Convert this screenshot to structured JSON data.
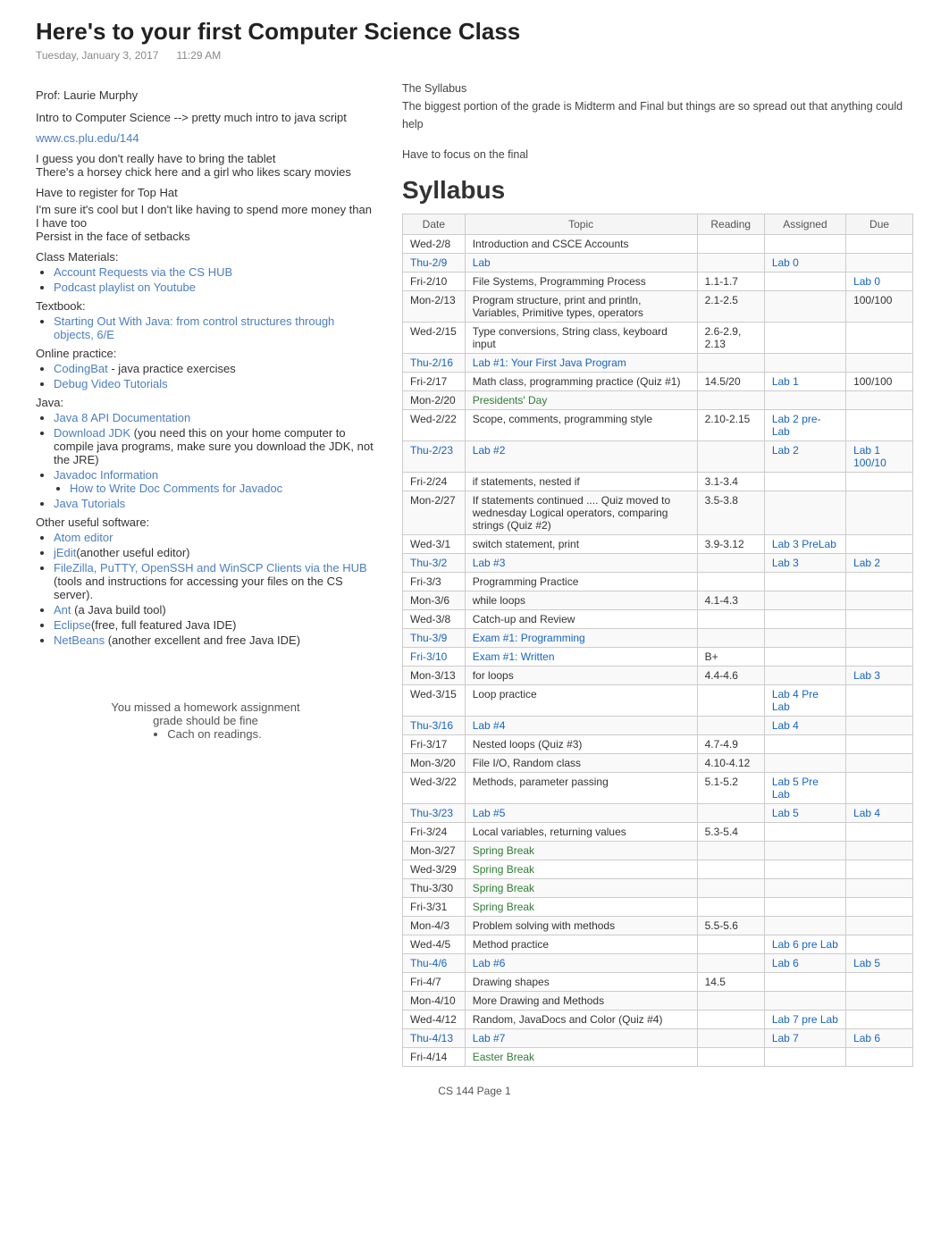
{
  "header": {
    "title": "Here's to your first Computer Science Class",
    "date": "Tuesday, January 3, 2017",
    "time": "11:29 AM"
  },
  "left": {
    "prof_label": "Prof: Laurie Murphy",
    "course_desc": "Intro to Computer Science --> pretty much intro to java script",
    "link_url": "www.cs.plu.edu/144",
    "notes": [
      "I guess you don't really have to bring the tablet",
      "There's a horsey chick here and a girl who likes scary movies"
    ],
    "register_note": "Have to register for Top Hat",
    "persist_notes": [
      "I'm sure it's cool but I don't like having to spend more money than I have too",
      "Persist in the face of setbacks"
    ],
    "class_materials_label": "Class Materials:",
    "class_materials": [
      {
        "text": "Account Requests via the CS HUB",
        "href": "#"
      },
      {
        "text": "Podcast playlist on Youtube",
        "href": "#"
      }
    ],
    "textbook_label": "Textbook:",
    "textbook": [
      {
        "text": "Starting Out With Java: from control structures through objects, 6/E",
        "href": "#"
      }
    ],
    "online_label": "Online practice:",
    "online": [
      {
        "text": "CodingBat",
        "href": "#",
        "suffix": " - java practice exercises"
      },
      {
        "text": "Debug Video Tutorials",
        "href": "#"
      }
    ],
    "java_label": "Java:",
    "java": [
      {
        "text": "Java 8 API Documentation",
        "href": "#"
      },
      {
        "text": "Download JDK",
        "href": "#",
        "suffix": " (you need this on your home computer to compile java programs, make sure you download the JDK, not the JRE)"
      },
      {
        "text": "Javadoc Information",
        "href": "#",
        "children": [
          {
            "text": "How to Write Doc Comments for Javadoc",
            "href": "#"
          }
        ]
      },
      {
        "text": "Java Tutorials",
        "href": "#"
      }
    ],
    "other_label": "Other useful software:",
    "other": [
      {
        "text": "Atom editor",
        "href": "#"
      },
      {
        "text": "jEdit",
        "href": "#",
        "suffix": "(another useful editor)"
      },
      {
        "text": "FileZilla, PuTTY, OpenSSH and WinSCP Clients via the HUB",
        "href": "#",
        "suffix": " (tools and instructions for accessing your files on the CS server)."
      },
      {
        "text": "Ant",
        "href": "#",
        "suffix": " (a Java build tool)"
      },
      {
        "text": "Eclipse",
        "href": "#",
        "suffix": "(free, full featured Java IDE)"
      },
      {
        "text": "NetBeans",
        "href": "#",
        "suffix": " (another excellent and free Java IDE)"
      }
    ],
    "note_box": {
      "line1": "You missed a homework assignment",
      "line2": "grade should be fine",
      "bullet": "Cach on readings."
    }
  },
  "right": {
    "syllabus_intro_label": "The Syllabus",
    "syllabus_intro": "The biggest portion of the grade is Midterm and Final but things are so spread out that anything could help",
    "syllabus_note": "Have to focus on the final",
    "syllabus_title": "Syllabus",
    "table_headers": [
      "Date",
      "Topic",
      "Reading",
      "Assigned",
      "Due"
    ],
    "rows": [
      {
        "date": "Wed-2/8",
        "topic": "Introduction and CSCE Accounts",
        "reading": "",
        "assigned": "",
        "due": "",
        "style": "normal"
      },
      {
        "date": "Thu-2/9",
        "topic": "Lab",
        "reading": "",
        "assigned": "Lab 0",
        "due": "",
        "style": "lab",
        "topic_color": "blue",
        "assigned_color": "blue"
      },
      {
        "date": "Fri-2/10",
        "topic": "File Systems, Programming Process",
        "reading": "1.1-1.7",
        "assigned": "",
        "due": "Lab 0",
        "due_color": "blue",
        "style": "normal"
      },
      {
        "date": "Mon-2/13",
        "topic": "Program structure, print and println, Variables, Primitive types, operators",
        "reading": "2.1-2.5",
        "assigned": "",
        "due": "100/100",
        "style": "normal"
      },
      {
        "date": "Wed-2/15",
        "topic": "Type conversions, String class, keyboard input",
        "reading": "2.6-2.9, 2.13",
        "assigned": "",
        "due": "",
        "style": "normal"
      },
      {
        "date": "Thu-2/16",
        "topic": "Lab #1: Your First Java Program",
        "reading": "",
        "assigned": "",
        "due": "",
        "style": "lab",
        "topic_color": "blue"
      },
      {
        "date": "Fri-2/17",
        "topic": "Math class, programming practice (Quiz #1)",
        "reading": "14.5/20",
        "assigned": "Lab 1",
        "due": "100/100",
        "assigned_color": "blue",
        "style": "normal"
      },
      {
        "date": "Mon-2/20",
        "topic": "Presidents' Day",
        "reading": "",
        "assigned": "",
        "due": "",
        "style": "holiday",
        "topic_color": "green"
      },
      {
        "date": "Wed-2/22",
        "topic": "Scope, comments, programming style",
        "reading": "2.10-2.15",
        "assigned": "Lab 2 pre-Lab",
        "due": "",
        "assigned_color": "blue",
        "style": "normal"
      },
      {
        "date": "Thu-2/23",
        "topic": "Lab #2",
        "reading": "",
        "assigned": "Lab 2",
        "due": "Lab 1 100/10",
        "style": "lab",
        "topic_color": "blue",
        "assigned_color": "blue",
        "due_color": "blue"
      },
      {
        "date": "Fri-2/24",
        "topic": "if statements, nested if",
        "reading": "3.1-3.4",
        "assigned": "",
        "due": "",
        "style": "normal"
      },
      {
        "date": "Mon-2/27",
        "topic": "If statements continued .... Quiz moved to wednesday Logical operators, comparing strings (Quiz #2)",
        "reading": "3.5-3.8",
        "assigned": "",
        "due": "",
        "style": "normal"
      },
      {
        "date": "Wed-3/1",
        "topic": "switch statement, print",
        "reading": "3.9-3.12",
        "assigned": "Lab 3 PreLab",
        "due": "",
        "assigned_color": "blue",
        "style": "normal"
      },
      {
        "date": "Thu-3/2",
        "topic": "Lab #3",
        "reading": "",
        "assigned": "Lab 3",
        "due": "Lab 2",
        "style": "lab",
        "topic_color": "blue",
        "assigned_color": "blue",
        "due_color": "blue"
      },
      {
        "date": "Fri-3/3",
        "topic": "Programming Practice",
        "reading": "",
        "assigned": "",
        "due": "",
        "style": "normal"
      },
      {
        "date": "Mon-3/6",
        "topic": "while loops",
        "reading": "4.1-4.3",
        "assigned": "",
        "due": "",
        "style": "normal"
      },
      {
        "date": "Wed-3/8",
        "topic": "Catch-up and Review",
        "reading": "",
        "assigned": "",
        "due": "",
        "style": "normal"
      },
      {
        "date": "Thu-3/9",
        "topic": "Exam #1: Programming",
        "reading": "",
        "assigned": "",
        "due": "",
        "style": "exam",
        "topic_color": "blue"
      },
      {
        "date": "Fri-3/10",
        "topic": "Exam #1: Written",
        "reading": "B+",
        "assigned": "",
        "due": "",
        "style": "exam",
        "topic_color": "blue"
      },
      {
        "date": "Mon-3/13",
        "topic": "for loops",
        "reading": "4.4-4.6",
        "assigned": "",
        "due": "Lab 3",
        "due_color": "blue",
        "style": "normal"
      },
      {
        "date": "Wed-3/15",
        "topic": "Loop practice",
        "reading": "",
        "assigned": "Lab 4 Pre Lab",
        "due": "",
        "assigned_color": "blue",
        "style": "normal"
      },
      {
        "date": "Thu-3/16",
        "topic": "Lab #4",
        "reading": "",
        "assigned": "Lab 4",
        "due": "",
        "style": "lab",
        "topic_color": "blue",
        "assigned_color": "blue"
      },
      {
        "date": "Fri-3/17",
        "topic": "Nested loops (Quiz #3)",
        "reading": "4.7-4.9",
        "assigned": "",
        "due": "",
        "style": "normal"
      },
      {
        "date": "Mon-3/20",
        "topic": "File I/O, Random class",
        "reading": "4.10-4.12",
        "assigned": "",
        "due": "",
        "style": "normal"
      },
      {
        "date": "Wed-3/22",
        "topic": "Methods, parameter passing",
        "reading": "5.1-5.2",
        "assigned": "Lab 5 Pre Lab",
        "due": "",
        "assigned_color": "blue",
        "style": "normal"
      },
      {
        "date": "Thu-3/23",
        "topic": "Lab #5",
        "reading": "",
        "assigned": "Lab 5",
        "due": "Lab 4",
        "style": "lab",
        "topic_color": "blue",
        "assigned_color": "blue",
        "due_color": "blue"
      },
      {
        "date": "Fri-3/24",
        "topic": "Local variables, returning values",
        "reading": "5.3-5.4",
        "assigned": "",
        "due": "",
        "style": "normal"
      },
      {
        "date": "Mon-3/27",
        "topic": "Spring Break",
        "reading": "",
        "assigned": "",
        "due": "",
        "style": "spring",
        "topic_color": "green"
      },
      {
        "date": "Wed-3/29",
        "topic": "Spring Break",
        "reading": "",
        "assigned": "",
        "due": "",
        "style": "spring",
        "topic_color": "green"
      },
      {
        "date": "Thu-3/30",
        "topic": "Spring Break",
        "reading": "",
        "assigned": "",
        "due": "",
        "style": "spring",
        "topic_color": "green"
      },
      {
        "date": "Fri-3/31",
        "topic": "Spring Break",
        "reading": "",
        "assigned": "",
        "due": "",
        "style": "spring",
        "topic_color": "green"
      },
      {
        "date": "Mon-4/3",
        "topic": "Problem solving with methods",
        "reading": "5.5-5.6",
        "assigned": "",
        "due": "",
        "style": "normal"
      },
      {
        "date": "Wed-4/5",
        "topic": "Method practice",
        "reading": "",
        "assigned": "Lab 6 pre Lab",
        "due": "",
        "assigned_color": "blue",
        "style": "normal"
      },
      {
        "date": "Thu-4/6",
        "topic": "Lab #6",
        "reading": "",
        "assigned": "Lab 6",
        "due": "Lab 5",
        "style": "lab",
        "topic_color": "blue",
        "assigned_color": "blue",
        "due_color": "blue"
      },
      {
        "date": "Fri-4/7",
        "topic": "Drawing shapes",
        "reading": "14.5",
        "assigned": "",
        "due": "",
        "style": "normal"
      },
      {
        "date": "Mon-4/10",
        "topic": "More Drawing and Methods",
        "reading": "",
        "assigned": "",
        "due": "",
        "style": "normal"
      },
      {
        "date": "Wed-4/12",
        "topic": "Random, JavaDocs and Color (Quiz #4)",
        "reading": "",
        "assigned": "Lab 7 pre Lab",
        "due": "",
        "assigned_color": "blue",
        "style": "normal"
      },
      {
        "date": "Thu-4/13",
        "topic": "Lab #7",
        "reading": "",
        "assigned": "Lab 7",
        "due": "Lab 6",
        "style": "lab",
        "topic_color": "blue",
        "assigned_color": "blue",
        "due_color": "blue"
      },
      {
        "date": "Fri-4/14",
        "topic": "Easter Break",
        "reading": "",
        "assigned": "",
        "due": "",
        "style": "holiday",
        "topic_color": "green"
      }
    ]
  },
  "footer": "CS 144 Page 1"
}
